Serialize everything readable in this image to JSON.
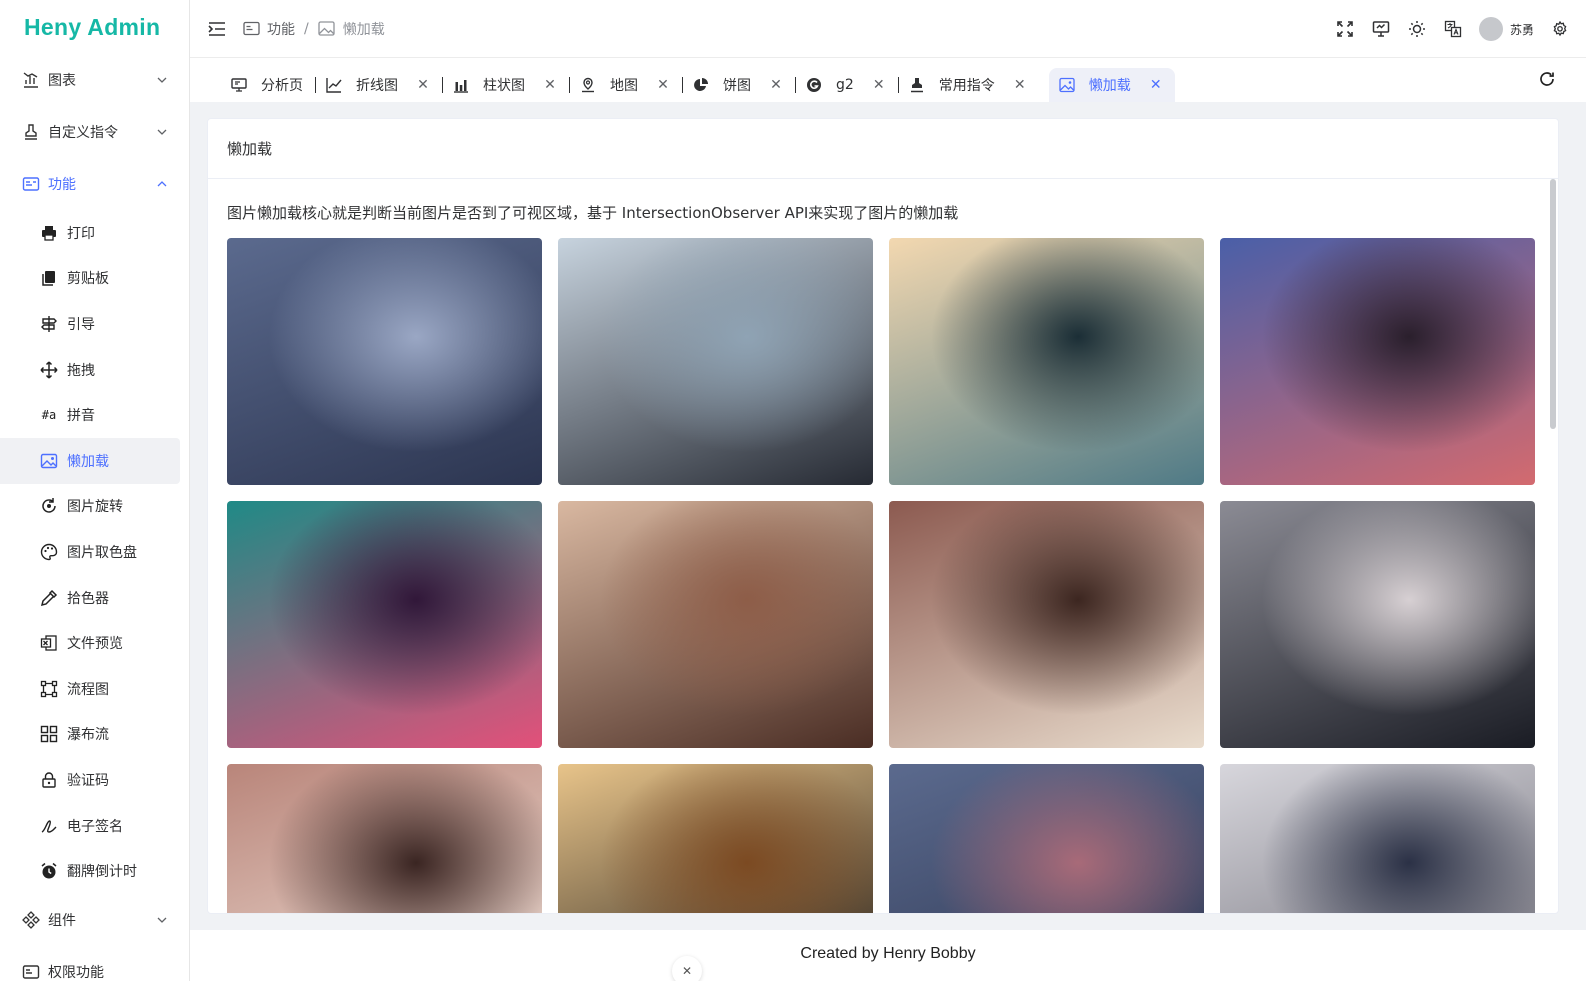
{
  "app": {
    "logo": "Heny Admin"
  },
  "sidebar": {
    "groups_top": [
      {
        "label": "图表",
        "icon": "chart-icon"
      },
      {
        "label": "自定义指令",
        "icon": "stamp-icon"
      },
      {
        "label": "功能",
        "icon": "id-card-icon"
      }
    ],
    "sub_items": [
      {
        "label": "打印",
        "icon": "printer-icon"
      },
      {
        "label": "剪贴板",
        "icon": "clipboard-icon"
      },
      {
        "label": "引导",
        "icon": "signpost-icon"
      },
      {
        "label": "拖拽",
        "icon": "drag-icon"
      },
      {
        "label": "拼音",
        "icon": "pinyin-icon"
      },
      {
        "label": "懒加载",
        "icon": "image-icon"
      },
      {
        "label": "图片旋转",
        "icon": "rotate-icon"
      },
      {
        "label": "图片取色盘",
        "icon": "palette-icon"
      },
      {
        "label": "拾色器",
        "icon": "eyedropper-icon"
      },
      {
        "label": "文件预览",
        "icon": "file-excel-icon"
      },
      {
        "label": "流程图",
        "icon": "flowchart-icon"
      },
      {
        "label": "瀑布流",
        "icon": "grid-icon"
      },
      {
        "label": "验证码",
        "icon": "lock-icon"
      },
      {
        "label": "电子签名",
        "icon": "signature-icon"
      },
      {
        "label": "翻牌倒计时",
        "icon": "alarm-icon"
      }
    ],
    "groups_bottom": [
      {
        "label": "组件",
        "icon": "components-icon"
      },
      {
        "label": "权限功能",
        "icon": "permission-icon"
      }
    ]
  },
  "header": {
    "breadcrumb": [
      "功能",
      "懒加载"
    ],
    "username": "苏勇"
  },
  "tabs": [
    {
      "label": "分析页",
      "icon": "monitor-icon",
      "closable": false
    },
    {
      "label": "折线图",
      "icon": "line-chart-icon",
      "closable": true
    },
    {
      "label": "柱状图",
      "icon": "bar-chart-icon",
      "closable": true
    },
    {
      "label": "地图",
      "icon": "map-pin-icon",
      "closable": true
    },
    {
      "label": "饼图",
      "icon": "pie-chart-icon",
      "closable": true
    },
    {
      "label": "g2",
      "icon": "g2-icon",
      "closable": true
    },
    {
      "label": "常用指令",
      "icon": "stamp-icon",
      "closable": true
    },
    {
      "label": "懒加载",
      "icon": "image-icon",
      "closable": true
    }
  ],
  "card": {
    "title": "懒加载",
    "description": "图片懒加载核心就是判断当前图片是否到了可视区域，基于 IntersectionObserver API来实现了图片的懒加载"
  },
  "images": [
    {
      "name": "anime-girl-blue-hair-profile",
      "colors": [
        "#5b6a8e",
        "#2c3550",
        "#9aa7c4"
      ]
    },
    {
      "name": "anime-girl-portrait-front",
      "colors": [
        "#c7d3de",
        "#262a33",
        "#8fa3b4"
      ]
    },
    {
      "name": "warriors-on-misty-mountains",
      "colors": [
        "#f3d8b0",
        "#4f7a86",
        "#1b2e36"
      ]
    },
    {
      "name": "castle-at-sunset-landscape",
      "colors": [
        "#4a5fa8",
        "#d36a6f",
        "#2a1f2c"
      ]
    },
    {
      "name": "neon-futuristic-city",
      "colors": [
        "#1f8a86",
        "#e3507a",
        "#311739"
      ]
    },
    {
      "name": "woman-portrait-warm",
      "colors": [
        "#d9b8a1",
        "#4a2d24",
        "#8e5d48"
      ]
    },
    {
      "name": "woman-white-robe",
      "colors": [
        "#8c5a50",
        "#e9dccd",
        "#3c2620"
      ]
    },
    {
      "name": "anime-girl-hair-ornament",
      "colors": [
        "#8b8b94",
        "#1a1c24",
        "#d7d0d3"
      ]
    },
    {
      "name": "woman-eyes-closed",
      "colors": [
        "#b9857a",
        "#f2e5dc",
        "#3a2522"
      ]
    },
    {
      "name": "golden-temple-fantasy",
      "colors": [
        "#e8c48a",
        "#1c1816",
        "#7c4a22"
      ]
    },
    {
      "name": "anime-girl-blue-hair-profile-2",
      "colors": [
        "#5b6a8e",
        "#2c3550",
        "#a86a78"
      ]
    },
    {
      "name": "anime-girl-white-hair",
      "colors": [
        "#d7d6dc",
        "#6b6a74",
        "#2b3146"
      ]
    }
  ],
  "footer": {
    "text": "Created by Henry Bobby"
  },
  "colors": {
    "accent": "#4d70ff",
    "logo": "#16b8a6"
  }
}
